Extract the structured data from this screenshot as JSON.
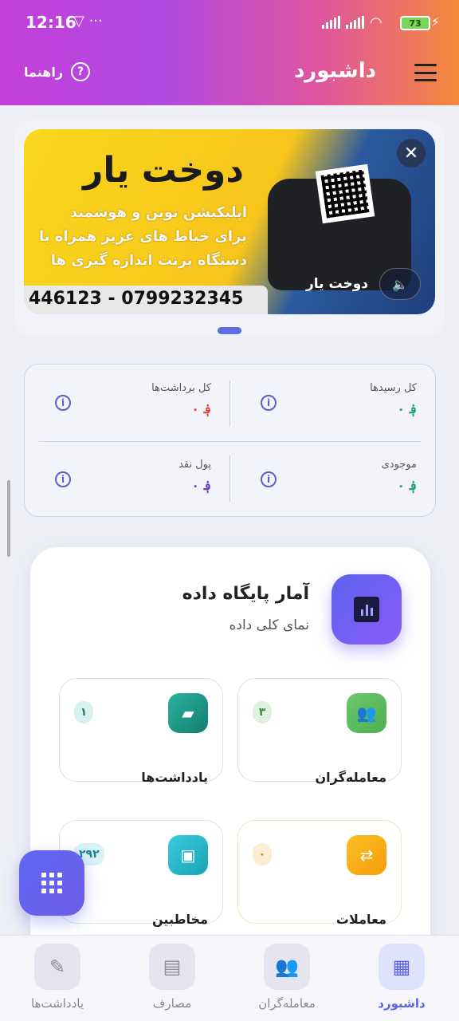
{
  "status_bar": {
    "time": "12:16",
    "battery": "73"
  },
  "header": {
    "title": "داشبورد",
    "help_label": "راهنما"
  },
  "banner": {
    "title": "دوخت یار",
    "line1": "اپلیکیشن نوین و هوشمند",
    "line2": "برای خیاط های عزیز همراه با",
    "line3": "دستگاه پرنت اندازه گیری ها",
    "phones": "446123 - 0799232345",
    "app_name": "دوخت یار"
  },
  "summary": {
    "total_receipts": {
      "label": "کل رسیدها",
      "value": "۰ ؋"
    },
    "total_withdrawals": {
      "label": "کل برداشت‌ها",
      "value": "۰ ؋"
    },
    "balance": {
      "label": "موجودی",
      "value": "۰ ؋"
    },
    "cash": {
      "label": "پول نقد",
      "value": "۰ ؋"
    }
  },
  "stats": {
    "title": "آمار پایگاه داده",
    "subtitle": "نمای کلی داده",
    "tiles": [
      {
        "label": "معامله‌گران",
        "count": "۳",
        "color": "#5cb85c",
        "icon": "people-icon"
      },
      {
        "label": "یادداشت‌ها",
        "count": "۱",
        "color": "#1e9a8a",
        "icon": "note-icon"
      },
      {
        "label": "معاملات",
        "count": "۰",
        "color": "#f59e0b",
        "icon": "swap-icon"
      },
      {
        "label": "مخاطبین",
        "count": "۲۹۲",
        "color": "#1fb5c9",
        "icon": "contacts-icon"
      }
    ]
  },
  "bottom_nav": {
    "items": [
      {
        "label": "داشبورد",
        "active": true
      },
      {
        "label": "معامله‌گران",
        "active": false
      },
      {
        "label": "مصارف",
        "active": false
      },
      {
        "label": "یادداشت‌ها",
        "active": false
      }
    ]
  }
}
